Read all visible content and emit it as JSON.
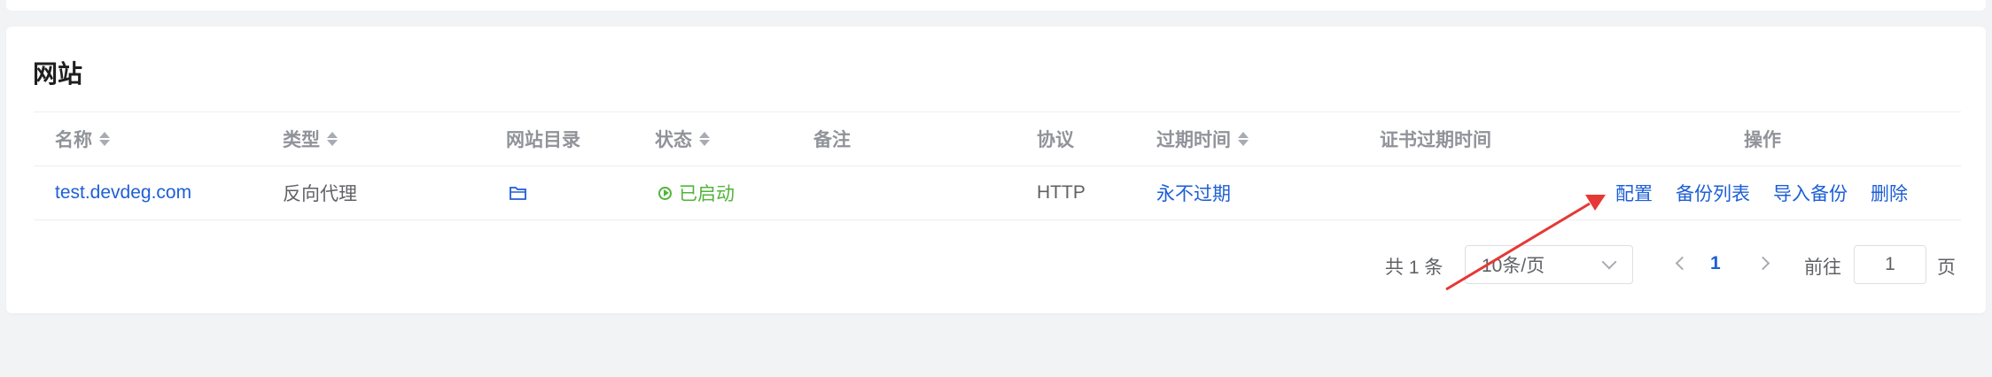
{
  "card": {
    "title": "网站"
  },
  "columns": {
    "name": "名称",
    "type": "类型",
    "dir": "网站目录",
    "status": "状态",
    "remark": "备注",
    "protocol": "协议",
    "expire": "过期时间",
    "cert_expire": "证书过期时间",
    "ops": "操作"
  },
  "rows": [
    {
      "name": "test.devdeg.com",
      "type": "反向代理",
      "dir_icon": "folder-icon",
      "status": "已启动",
      "remark": "",
      "protocol": "HTTP",
      "expire": "永不过期",
      "cert_expire": "",
      "ops": [
        "配置",
        "备份列表",
        "导入备份",
        "删除"
      ]
    }
  ],
  "pagination": {
    "total": "共 1 条",
    "page_size": "10条/页",
    "current_page": "1",
    "goto_label": "前往",
    "goto_value": "1",
    "page_suffix": "页"
  },
  "colors": {
    "link": "#1d5fd6",
    "success": "#52b43a",
    "annotation_arrow": "#e53935"
  }
}
